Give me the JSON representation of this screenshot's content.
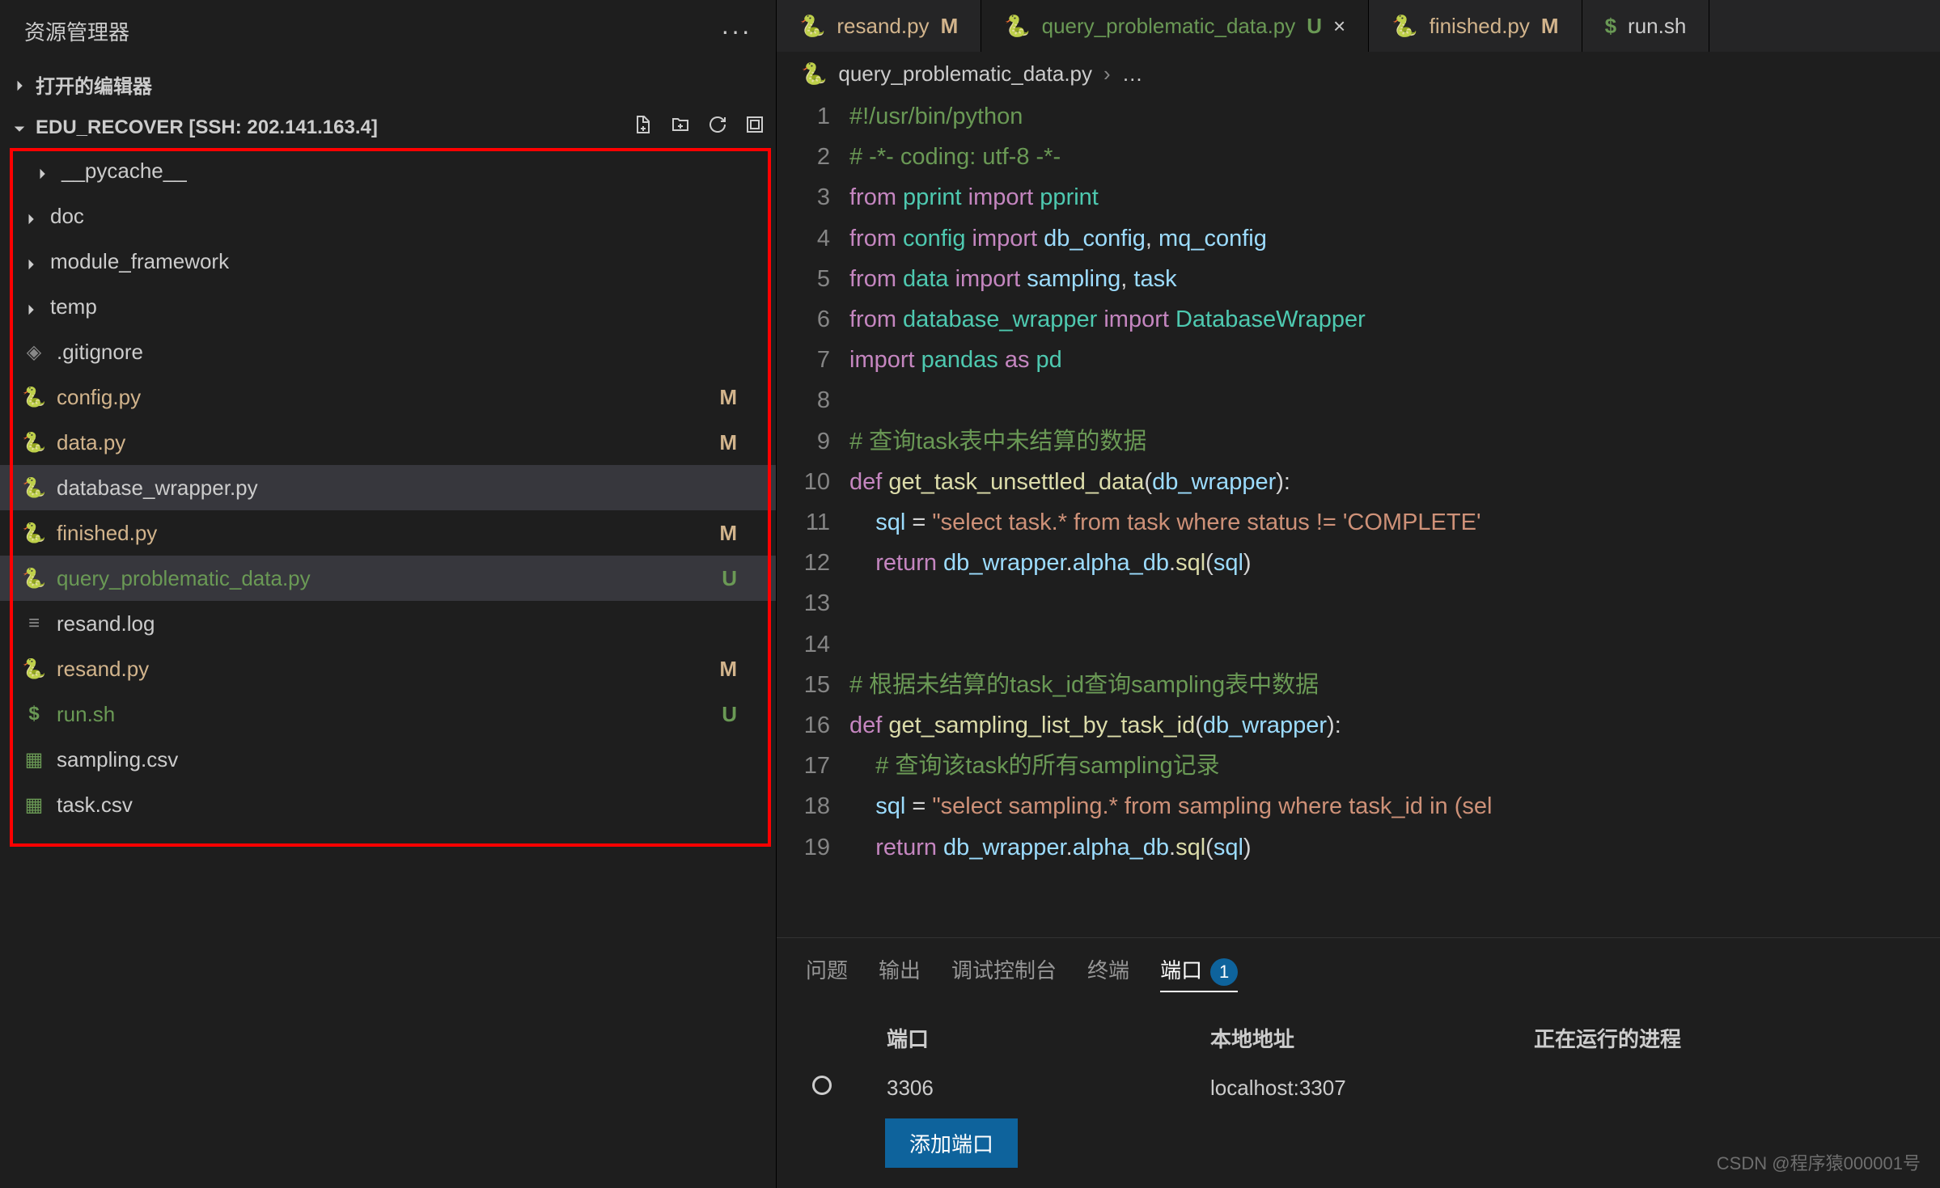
{
  "menubar": "⋯",
  "explorer": {
    "title": "资源管理器",
    "open_editors": "打开的编辑器",
    "workspace": "EDU_RECOVER [SSH: 202.141.163.4]",
    "toolbar": {
      "new_file": "",
      "new_folder": "",
      "refresh": "",
      "collapse": ""
    }
  },
  "files": [
    {
      "name": "__pycache__",
      "type": "folder",
      "badge": "",
      "cls": ""
    },
    {
      "name": "doc",
      "type": "folder",
      "badge": "",
      "cls": ""
    },
    {
      "name": "module_framework",
      "type": "folder",
      "badge": "",
      "cls": ""
    },
    {
      "name": "temp",
      "type": "folder",
      "badge": "",
      "cls": ""
    },
    {
      "name": ".gitignore",
      "type": "gitignore",
      "badge": "",
      "cls": ""
    },
    {
      "name": "config.py",
      "type": "py",
      "badge": "M",
      "cls": "golden"
    },
    {
      "name": "data.py",
      "type": "py",
      "badge": "M",
      "cls": "golden"
    },
    {
      "name": "database_wrapper.py",
      "type": "py",
      "badge": "",
      "cls": "",
      "selected": true
    },
    {
      "name": "finished.py",
      "type": "py",
      "badge": "M",
      "cls": "golden"
    },
    {
      "name": "query_problematic_data.py",
      "type": "py",
      "badge": "U",
      "cls": "green-text",
      "active": true
    },
    {
      "name": "resand.log",
      "type": "log",
      "badge": "",
      "cls": ""
    },
    {
      "name": "resand.py",
      "type": "py",
      "badge": "M",
      "cls": "golden"
    },
    {
      "name": "run.sh",
      "type": "sh",
      "badge": "U",
      "cls": "green-text"
    },
    {
      "name": "sampling.csv",
      "type": "csv",
      "badge": "",
      "cls": ""
    },
    {
      "name": "task.csv",
      "type": "csv",
      "badge": "",
      "cls": ""
    }
  ],
  "tabs": [
    {
      "label": "resand.py",
      "badge": "M",
      "badgeClass": "golden",
      "active": false,
      "icon": "py"
    },
    {
      "label": "query_problematic_data.py",
      "badge": "U",
      "badgeClass": "green-text",
      "active": true,
      "icon": "py",
      "close": true
    },
    {
      "label": "finished.py",
      "badge": "M",
      "badgeClass": "golden",
      "active": false,
      "icon": "py"
    },
    {
      "label": "run.sh",
      "badge": "",
      "badgeClass": "",
      "active": false,
      "icon": "sh"
    }
  ],
  "breadcrumb": {
    "file": "query_problematic_data.py",
    "ellipsis": "…"
  },
  "code": {
    "lines": [
      [
        {
          "t": "#!/usr/bin/python",
          "c": "tk-cmt"
        }
      ],
      [
        {
          "t": "# -*- coding: utf-8 -*-",
          "c": "tk-cmt"
        }
      ],
      [
        {
          "t": "from",
          "c": "tk-kw"
        },
        {
          "t": " pprint ",
          "c": "tk-type"
        },
        {
          "t": "import",
          "c": "tk-kw"
        },
        {
          "t": " pprint",
          "c": "tk-type"
        }
      ],
      [
        {
          "t": "from",
          "c": "tk-kw"
        },
        {
          "t": " config ",
          "c": "tk-type"
        },
        {
          "t": "import",
          "c": "tk-kw"
        },
        {
          "t": " db_config",
          "c": "tk-var"
        },
        {
          "t": ", ",
          "c": ""
        },
        {
          "t": "mq_config",
          "c": "tk-var"
        }
      ],
      [
        {
          "t": "from",
          "c": "tk-kw"
        },
        {
          "t": " data ",
          "c": "tk-type"
        },
        {
          "t": "import",
          "c": "tk-kw"
        },
        {
          "t": " sampling",
          "c": "tk-var"
        },
        {
          "t": ", ",
          "c": ""
        },
        {
          "t": "task",
          "c": "tk-var"
        }
      ],
      [
        {
          "t": "from",
          "c": "tk-kw"
        },
        {
          "t": " database_wrapper ",
          "c": "tk-type"
        },
        {
          "t": "import",
          "c": "tk-kw"
        },
        {
          "t": " DatabaseWrapper",
          "c": "tk-type"
        }
      ],
      [
        {
          "t": "import",
          "c": "tk-kw"
        },
        {
          "t": " pandas ",
          "c": "tk-type"
        },
        {
          "t": "as",
          "c": "tk-kw"
        },
        {
          "t": " pd",
          "c": "tk-type"
        }
      ],
      [],
      [
        {
          "t": "# 查询task表中未结算的数据",
          "c": "tk-cmt"
        }
      ],
      [
        {
          "t": "def ",
          "c": "tk-kw"
        },
        {
          "t": "get_task_unsettled_data",
          "c": "tk-fn"
        },
        {
          "t": "(",
          "c": ""
        },
        {
          "t": "db_wrapper",
          "c": "tk-var"
        },
        {
          "t": "):",
          "c": ""
        }
      ],
      [
        {
          "t": "    sql ",
          "c": "tk-var"
        },
        {
          "t": "= ",
          "c": ""
        },
        {
          "t": "\"select task.* from task where status != 'COMPLETE'",
          "c": "tk-str"
        }
      ],
      [
        {
          "t": "    ",
          "c": ""
        },
        {
          "t": "return",
          "c": "tk-kw"
        },
        {
          "t": " db_wrapper",
          "c": "tk-var"
        },
        {
          "t": ".",
          "c": ""
        },
        {
          "t": "alpha_db",
          "c": "tk-var"
        },
        {
          "t": ".",
          "c": ""
        },
        {
          "t": "sql",
          "c": "tk-fn"
        },
        {
          "t": "(",
          "c": ""
        },
        {
          "t": "sql",
          "c": "tk-var"
        },
        {
          "t": ")",
          "c": ""
        }
      ],
      [],
      [],
      [
        {
          "t": "# 根据未结算的task_id查询sampling表中数据",
          "c": "tk-cmt"
        }
      ],
      [
        {
          "t": "def ",
          "c": "tk-kw"
        },
        {
          "t": "get_sampling_list_by_task_id",
          "c": "tk-fn"
        },
        {
          "t": "(",
          "c": ""
        },
        {
          "t": "db_wrapper",
          "c": "tk-var"
        },
        {
          "t": "):",
          "c": ""
        }
      ],
      [
        {
          "t": "    ",
          "c": ""
        },
        {
          "t": "# 查询该task的所有sampling记录",
          "c": "tk-cmt"
        }
      ],
      [
        {
          "t": "    sql ",
          "c": "tk-var"
        },
        {
          "t": "= ",
          "c": ""
        },
        {
          "t": "\"select sampling.* from sampling where task_id in (sel",
          "c": "tk-str"
        }
      ],
      [
        {
          "t": "    ",
          "c": ""
        },
        {
          "t": "return",
          "c": "tk-kw"
        },
        {
          "t": " db_wrapper",
          "c": "tk-var"
        },
        {
          "t": ".",
          "c": ""
        },
        {
          "t": "alpha_db",
          "c": "tk-var"
        },
        {
          "t": ".",
          "c": ""
        },
        {
          "t": "sql",
          "c": "tk-fn"
        },
        {
          "t": "(",
          "c": ""
        },
        {
          "t": "sql",
          "c": "tk-var"
        },
        {
          "t": ")",
          "c": ""
        }
      ]
    ]
  },
  "panel": {
    "tabs": [
      "问题",
      "输出",
      "调试控制台",
      "终端",
      "端口"
    ],
    "active_tab": 4,
    "badge": "1",
    "headers": {
      "port": "端口",
      "address": "本地地址",
      "process": "正在运行的进程"
    },
    "rows": [
      {
        "port": "3306",
        "address": "localhost:3307",
        "process": ""
      }
    ],
    "add_button": "添加端口"
  },
  "watermark": "CSDN @程序猿000001号"
}
